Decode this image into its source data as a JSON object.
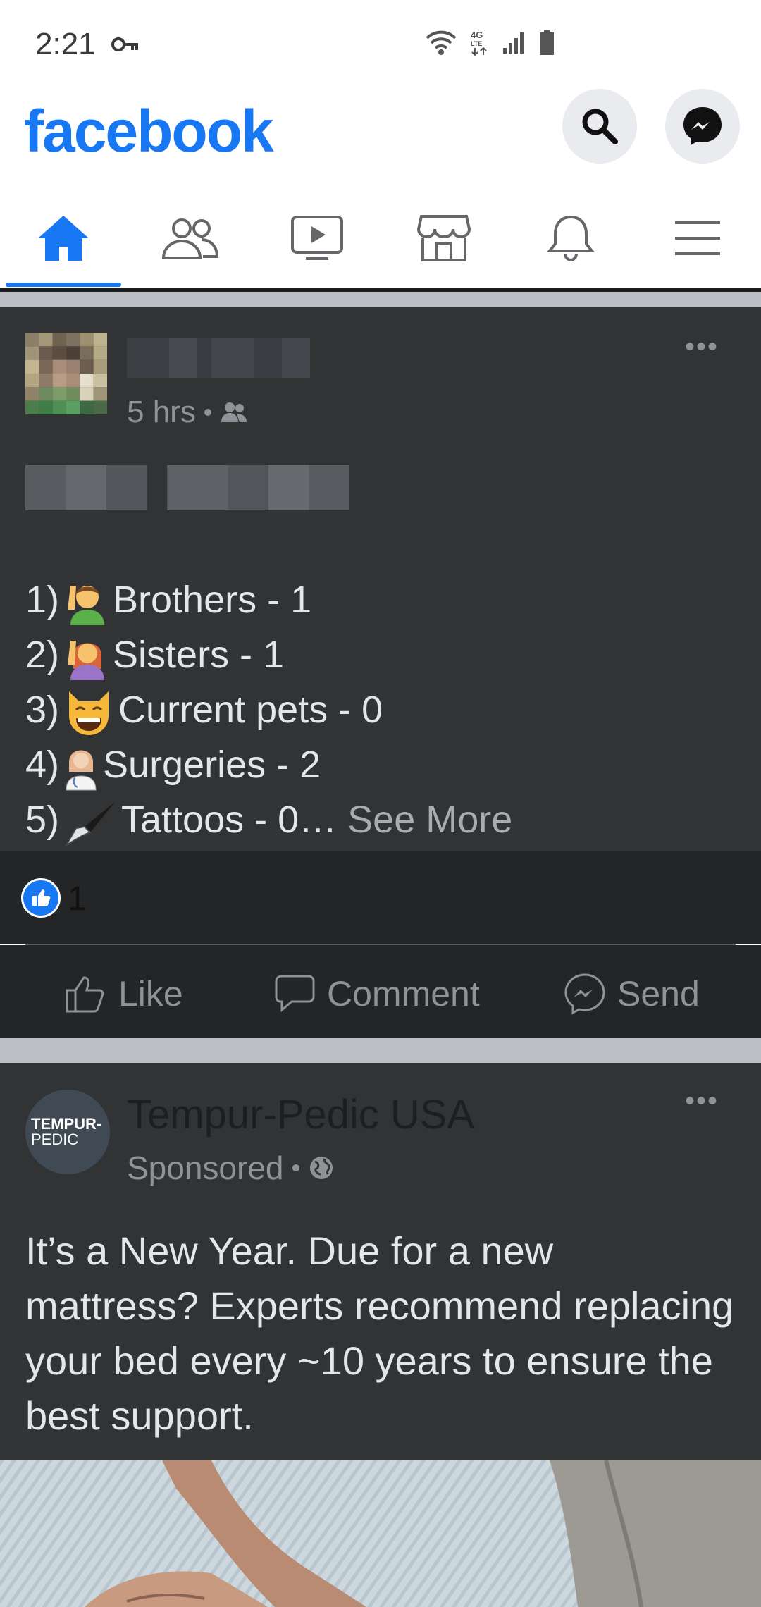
{
  "status_bar": {
    "time": "2:21",
    "network": "4G LTE"
  },
  "header": {
    "logo": "facebook",
    "search_icon": "search-icon",
    "messenger_icon": "messenger-icon"
  },
  "tabs": [
    {
      "name": "home",
      "icon": "home-icon",
      "active": true
    },
    {
      "name": "friends",
      "icon": "friends-icon"
    },
    {
      "name": "watch",
      "icon": "video-icon"
    },
    {
      "name": "marketplace",
      "icon": "store-icon"
    },
    {
      "name": "notifications",
      "icon": "bell-icon"
    },
    {
      "name": "menu",
      "icon": "hamburger-icon"
    }
  ],
  "post1": {
    "time": "5 hrs",
    "lines": [
      {
        "prefix": "1)",
        "text": "Brothers - 1"
      },
      {
        "prefix": "2)",
        "text": "Sisters - 1"
      },
      {
        "prefix": "3)",
        "text": "Current pets - 0"
      },
      {
        "prefix": "4)",
        "text": "Surgeries -  2"
      },
      {
        "prefix": "5)",
        "text": "Tattoos - 0…",
        "more": "See More"
      }
    ],
    "like_count": "1",
    "actions": {
      "like": "Like",
      "comment": "Comment",
      "send": "Send"
    }
  },
  "post2": {
    "page_name": "Tempur-Pedic USA",
    "logo_line1": "TEMPUR-",
    "logo_line2": "PEDIC",
    "meta": "Sponsored",
    "text": "It’s a New Year. Due for a new mattress? Experts recommend replacing your bed every ~10 years to ensure the best support."
  },
  "colors": {
    "brand": "#1877f2",
    "post_bg": "#323335",
    "bar_bg": "#242526",
    "separator": "#bcc0c4"
  }
}
